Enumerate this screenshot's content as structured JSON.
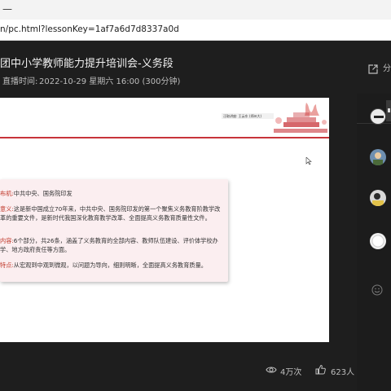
{
  "window": {
    "minimize_glyph": "—"
  },
  "browser": {
    "url": "n/pc.html?lessonKey=1af7a6d7d8337a0d"
  },
  "header": {
    "title": "团中小学教师能力提升培训会-义务段",
    "live_label": "直播时间:",
    "live_time": "2022-10-29 星期六 16:00 (300分钟)",
    "share_label": "分",
    "share_icon": "share-out-icon"
  },
  "slide": {
    "speaker_caption": "汪取讲座: 王云东 (郑州大)",
    "rows": [
      {
        "label": "布机:",
        "text": "中共中央、国务院印发"
      },
      {
        "label": "意义:",
        "text": "这是新中国成立70年来，中共中央、国务院印发的第一个聚焦义务教育阶教学改革的重要文件，是新时代我国深化教育教学改革、全面提高义务教育质量性文件。"
      },
      {
        "label": "内容:",
        "text": "6个部分，共26条，涵盖了义务教育的全部内容、教师队伍建设、评价体学校办学、地方政府责任等方面。"
      },
      {
        "label": "特点:",
        "text": "从宏观到中观到微观，以问题为导向，细则明晰，全面提高义务教育质量。"
      }
    ],
    "accent_color": "#c8343a"
  },
  "stats": {
    "views": "4万次",
    "likes": "623人",
    "views_icon": "eye-icon",
    "likes_icon": "thumbs-up-icon"
  },
  "panel": {
    "emoji_icon": "smiley-icon"
  }
}
